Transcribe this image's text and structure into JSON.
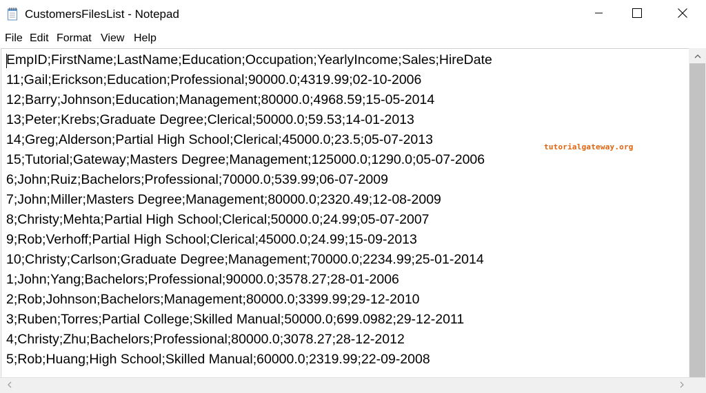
{
  "window": {
    "title": "CustomersFilesList - Notepad"
  },
  "menu": {
    "items": [
      "File",
      "Edit",
      "Format",
      "View",
      "Help"
    ]
  },
  "editor": {
    "lines": [
      "EmpID;FirstName;LastName;Education;Occupation;YearlyIncome;Sales;HireDate",
      "11;Gail;Erickson;Education;Professional;90000.0;4319.99;02-10-2006",
      "12;Barry;Johnson;Education;Management;80000.0;4968.59;15-05-2014",
      "13;Peter;Krebs;Graduate Degree;Clerical;50000.0;59.53;14-01-2013",
      "14;Greg;Alderson;Partial High School;Clerical;45000.0;23.5;05-07-2013",
      "15;Tutorial;Gateway;Masters Degree;Management;125000.0;1290.0;05-07-2006",
      "6;John;Ruiz;Bachelors;Professional;70000.0;539.99;06-07-2009",
      "7;John;Miller;Masters Degree;Management;80000.0;2320.49;12-08-2009",
      "8;Christy;Mehta;Partial High School;Clerical;50000.0;24.99;05-07-2007",
      "9;Rob;Verhoff;Partial High School;Clerical;45000.0;24.99;15-09-2013",
      "10;Christy;Carlson;Graduate Degree;Management;70000.0;2234.99;25-01-2014",
      "1;John;Yang;Bachelors;Professional;90000.0;3578.27;28-01-2006",
      "2;Rob;Johnson;Bachelors;Management;80000.0;3399.99;29-12-2010",
      "3;Ruben;Torres;Partial College;Skilled Manual;50000.0;699.0982;29-12-2011",
      "4;Christy;Zhu;Bachelors;Professional;80000.0;3078.27;28-12-2012",
      "5;Rob;Huang;High School;Skilled Manual;60000.0;2319.99;22-09-2008"
    ]
  },
  "watermark": "tutorialgateway.org",
  "icons": {
    "app": "notepad-icon",
    "minimize": "minimize-icon",
    "maximize": "maximize-icon",
    "close": "close-icon",
    "scroll_up": "chevron-up-icon",
    "scroll_left": "chevron-left-icon",
    "scroll_right": "chevron-right-icon"
  }
}
